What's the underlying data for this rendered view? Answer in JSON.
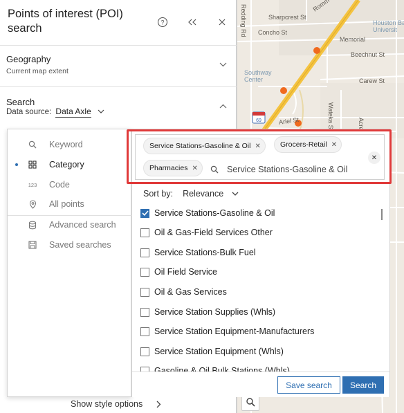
{
  "panel": {
    "title": "Points of interest (POI) search",
    "help_icon": "help-circle-icon",
    "collapse_icon": "chevrons-left-icon",
    "close_icon": "close-icon"
  },
  "geography": {
    "title": "Geography",
    "subtitle": "Current map extent"
  },
  "search_section": {
    "title": "Search",
    "data_source_label": "Data source:",
    "data_source_value": "Data Axle"
  },
  "menu": {
    "items": [
      {
        "label": "Keyword",
        "icon": "search-icon",
        "active": false
      },
      {
        "label": "Category",
        "icon": "grid-icon",
        "active": true
      },
      {
        "label": "Code",
        "icon": "code-123-icon",
        "active": false
      },
      {
        "label": "All points",
        "icon": "pin-icon",
        "active": false
      },
      {
        "label": "Advanced search",
        "icon": "database-icon",
        "active": false
      },
      {
        "label": "Saved searches",
        "icon": "save-icon",
        "active": false
      }
    ],
    "code_icon_text": "123"
  },
  "chips": [
    {
      "label": "Service Stations-Gasoline & Oil"
    },
    {
      "label": "Grocers-Retail"
    },
    {
      "label": "Pharmacies"
    }
  ],
  "category_search": {
    "value": "Service Stations-Gasoline & Oil"
  },
  "sort": {
    "label": "Sort by:",
    "value": "Relevance"
  },
  "categories": [
    {
      "label": "Service Stations-Gasoline & Oil",
      "checked": true
    },
    {
      "label": "Oil & Gas-Field Services Other",
      "checked": false
    },
    {
      "label": "Service Stations-Bulk Fuel",
      "checked": false
    },
    {
      "label": "Oil Field Service",
      "checked": false
    },
    {
      "label": "Oil & Gas Services",
      "checked": false
    },
    {
      "label": "Service Station Supplies (Whls)",
      "checked": false
    },
    {
      "label": "Service Station Equipment-Manufacturers",
      "checked": false
    },
    {
      "label": "Service Station Equipment (Whls)",
      "checked": false
    },
    {
      "label": "Gasoline & Oil Bulk Stations (Whls)",
      "checked": false
    }
  ],
  "buttons": {
    "save_search": "Save search",
    "search": "Search"
  },
  "footer": {
    "show_style": "Show style options"
  },
  "map": {
    "labels": {
      "redding": "Redding Rd",
      "romm": "Romm",
      "sharpcrest": "Sharpcrest St",
      "concho": "Concho St",
      "houston_baptist": "Houston Bapt\nUniversit",
      "memorial": "Memorial",
      "beechnut": "Beechnut St",
      "carew": "Carew St",
      "southway": "Southway\nCenter",
      "watetka": "Wateka St",
      "ariel": "Ariel St",
      "acres": "Acres",
      "shield": "69"
    },
    "colors": {
      "highway": "#f4c340",
      "poi": "#f06a1e",
      "land": "#efeae2"
    }
  },
  "colors": {
    "accent": "#2f6fb2",
    "highlight": "#e03a3a"
  }
}
